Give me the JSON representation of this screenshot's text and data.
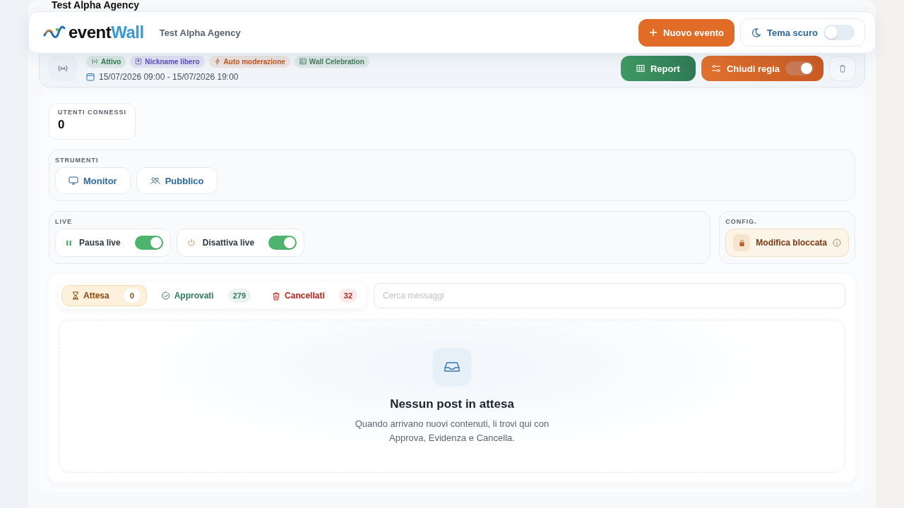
{
  "page_title": "Test Alpha Agency",
  "header": {
    "logo": {
      "part_1": "event",
      "part_2": "Wall"
    },
    "agency": "Test Alpha Agency",
    "new_event_button": "Nuovo evento",
    "dark_theme": {
      "label": "Tema scuro",
      "on": false
    }
  },
  "event": {
    "badges": [
      {
        "label": "Attivo",
        "kind": "signal",
        "color": "#2f7a4f"
      },
      {
        "label": "Nickname libero",
        "kind": "user",
        "color": "#5b4bbf"
      },
      {
        "label": "Auto moderazione",
        "kind": "bolt",
        "color": "#c0561d"
      },
      {
        "label": "Wall Celebration",
        "kind": "grid",
        "color": "#3f7a5a"
      }
    ],
    "dates": "15/07/2026 09:00 - 15/07/2026 19:00",
    "report_button": "Report",
    "direction_toggle": {
      "label": "Chiudi regia",
      "on": true
    }
  },
  "stats": [
    {
      "label": "UTENTI CONNESSI",
      "value": "0"
    }
  ],
  "tools": {
    "title": "STRUMENTI",
    "buttons": [
      {
        "label": "Monitor",
        "kind": "monitor"
      },
      {
        "label": "Pubblico",
        "kind": "users"
      }
    ]
  },
  "live": {
    "title": "LIVE",
    "switches": [
      {
        "label": "Pausa live",
        "kind": "pause",
        "on": true
      },
      {
        "label": "Disattiva live",
        "kind": "power",
        "on": true
      }
    ]
  },
  "config": {
    "title": "CONFIG.",
    "lock_label": "Modifica bloccata"
  },
  "moderation": {
    "tabs": [
      {
        "label": "Attesa",
        "count": "0",
        "kind": "hourglass",
        "color": "#8a4a12",
        "selected": true
      },
      {
        "label": "Approvati",
        "count": "279",
        "kind": "check",
        "color": "#2f7a5a",
        "selected": false
      },
      {
        "label": "Cancellati",
        "count": "32",
        "kind": "trash",
        "color": "#b3261e",
        "selected": false
      }
    ],
    "search": {
      "placeholder": "Cerca messaggi"
    },
    "empty": {
      "title": "Nessun post in attesa",
      "text": "Quando arrivano nuovi contenuti, li trovi qui con Approva, Evidenza e Cancella."
    }
  }
}
